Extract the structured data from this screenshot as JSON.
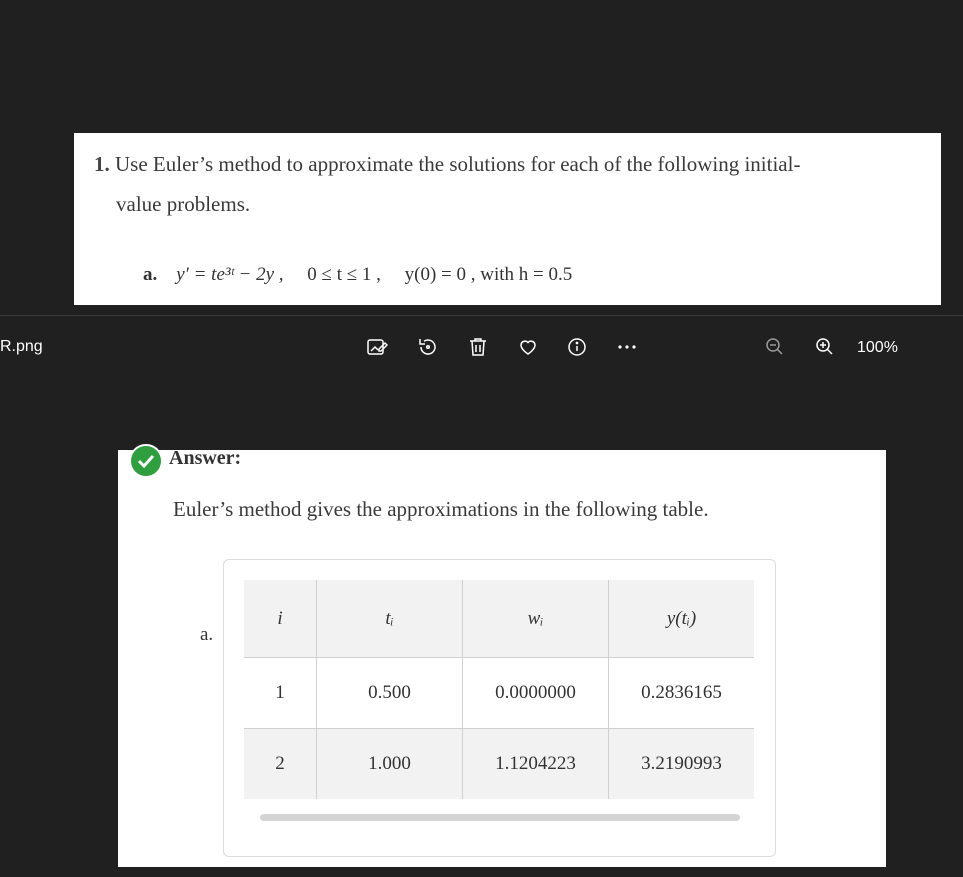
{
  "question": {
    "number": "1.",
    "text_line1": "Use Euler’s method to approximate the solutions for each of the following initial-",
    "text_line2": "value problems.",
    "part_label": "a.",
    "equation": "y′ = te³ᵗ − 2y ,",
    "domain": "0 ≤ t ≤ 1 ,",
    "initial": "y(0) = 0 , with h = 0.5"
  },
  "toolbar": {
    "filename": "R.png",
    "zoom_level": "100%",
    "icons": [
      "edit-image-icon",
      "rotate-icon",
      "delete-icon",
      "favorite-icon",
      "info-icon",
      "more-icon",
      "zoom-out-icon",
      "zoom-in-icon"
    ]
  },
  "answer": {
    "label": "Answer:",
    "intro": "Euler’s method gives the approximations in the following table.",
    "part_label": "a.",
    "table": {
      "headers": [
        "i",
        "tᵢ",
        "wᵢ",
        "y(tᵢ)"
      ],
      "rows": [
        [
          "1",
          "0.500",
          "0.0000000",
          "0.2836165"
        ],
        [
          "2",
          "1.000",
          "1.1204223",
          "3.2190993"
        ]
      ]
    }
  },
  "colors": {
    "background": "#202020",
    "card": "#ffffff",
    "check": "#2e9e3e",
    "table_header": "#f2f2f2"
  }
}
